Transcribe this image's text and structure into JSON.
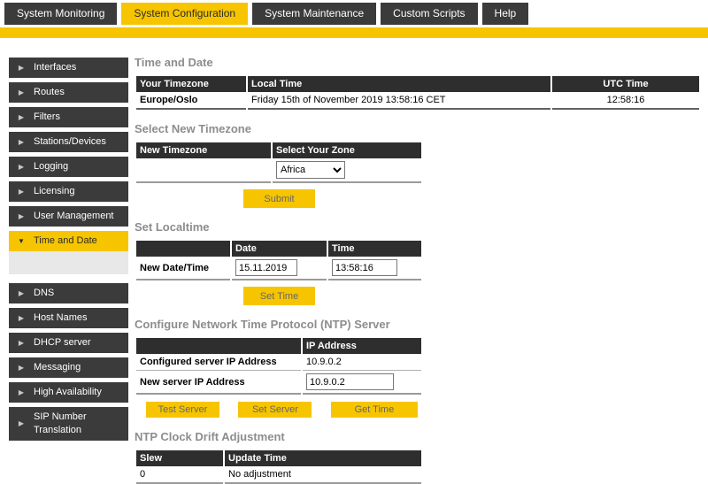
{
  "colors": {
    "accent": "#f6c500",
    "dark": "#3b3b3b",
    "table_header": "#2e2e2e"
  },
  "tabs": {
    "items": [
      {
        "label": "System Monitoring"
      },
      {
        "label": "System Configuration"
      },
      {
        "label": "System Maintenance"
      },
      {
        "label": "Custom Scripts"
      },
      {
        "label": "Help"
      }
    ]
  },
  "sidebar": {
    "items": [
      {
        "label": "Interfaces"
      },
      {
        "label": "Routes"
      },
      {
        "label": "Filters"
      },
      {
        "label": "Stations/Devices"
      },
      {
        "label": "Logging"
      },
      {
        "label": "Licensing"
      },
      {
        "label": "User Management"
      },
      {
        "label": "Time and Date"
      },
      {
        "label": "DNS"
      },
      {
        "label": "Host Names"
      },
      {
        "label": "DHCP server"
      },
      {
        "label": "Messaging"
      },
      {
        "label": "High Availability"
      },
      {
        "label": "SIP Number Translation"
      }
    ]
  },
  "sections": {
    "time_and_date": {
      "heading": "Time and Date",
      "headers": [
        "Your Timezone",
        "Local Time",
        "UTC Time"
      ],
      "row": {
        "timezone": "Europe/Oslo",
        "local_time": "Friday 15th of November 2019 13:58:16 CET",
        "utc_time": "12:58:16"
      }
    },
    "select_new_timezone": {
      "heading": "Select New Timezone",
      "headers": [
        "New Timezone",
        "Select Your Zone"
      ],
      "zone_selected": "Africa",
      "submit_label": "Submit"
    },
    "set_localtime": {
      "heading": "Set Localtime",
      "headers": [
        "Date",
        "Time"
      ],
      "row_label": "New Date/Time",
      "date_value": "15.11.2019",
      "time_value": "13:58:16",
      "set_time_label": "Set Time"
    },
    "ntp_server": {
      "heading": "Configure Network Time Protocol (NTP) Server",
      "header": "IP Address",
      "configured_label": "Configured server IP Address",
      "configured_value": "10.9.0.2",
      "new_label": "New server IP Address",
      "new_value": "10.9.0.2",
      "buttons": [
        "Test Server",
        "Set Server",
        "Get Time"
      ]
    },
    "ntp_drift": {
      "heading": "NTP Clock Drift Adjustment",
      "headers": [
        "Slew",
        "Update Time"
      ],
      "row": {
        "slew": "0",
        "update_time": "No adjustment"
      }
    }
  }
}
